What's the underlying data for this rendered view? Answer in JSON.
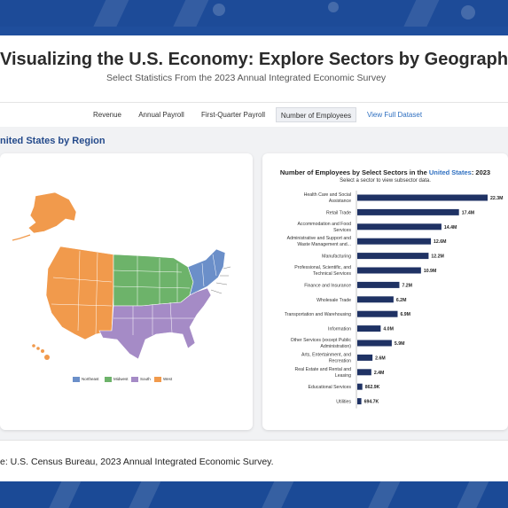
{
  "header": {
    "title": "Visualizing the U.S. Economy: Explore Sectors by Geography",
    "subtitle": "Select Statistics From the 2023 Annual Integrated Economic Survey"
  },
  "tabs": [
    {
      "label": "Revenue"
    },
    {
      "label": "Annual Payroll"
    },
    {
      "label": "First-Quarter Payroll"
    },
    {
      "label": "Number of Employees"
    },
    {
      "label": "View Full Dataset"
    }
  ],
  "map_panel": {
    "title": "nited States by Region",
    "legend": [
      {
        "label": "Northeast",
        "color": "#6b8fc9"
      },
      {
        "label": "Midwest",
        "color": "#6db36a"
      },
      {
        "label": "South",
        "color": "#a58bc6"
      },
      {
        "label": "West",
        "color": "#f19a4c"
      }
    ]
  },
  "chart_panel": {
    "title_prefix": "Number of Employees by Select Sectors in the",
    "title_highlight": "United States",
    "title_suffix": ": 2023",
    "subtitle": "Select a sector to view subsector data."
  },
  "chart_data": {
    "type": "bar",
    "orientation": "horizontal",
    "title": "Number of Employees by Select Sectors in the United States: 2023",
    "bar_color": "#1f3264",
    "categories": [
      [
        "Health Care and Social",
        "Assistance"
      ],
      [
        "Retail Trade"
      ],
      [
        "Accommodation and Food",
        "Services"
      ],
      [
        "Administrative and Support and",
        "Waste Management and..."
      ],
      [
        "Manufacturing"
      ],
      [
        "Professional, Scientific, and",
        "Technical Services"
      ],
      [
        "Finance and Insurance"
      ],
      [
        "Wholesale Trade"
      ],
      [
        "Transportation and Warehousing"
      ],
      [
        "Information"
      ],
      [
        "Other Services (except Public",
        "Administration)"
      ],
      [
        "Arts, Entertainment, and",
        "Recreation"
      ],
      [
        "Real Estate and Rental and",
        "Leasing"
      ],
      [
        "Educational Services"
      ],
      [
        "Utilities"
      ]
    ],
    "values": [
      22.3,
      17.4,
      14.4,
      12.6,
      12.2,
      10.9,
      7.2,
      6.2,
      6.9,
      4.0,
      5.9,
      2.6,
      2.4,
      0.8629,
      0.6947
    ],
    "value_labels": [
      "22.3M",
      "17.4M",
      "14.4M",
      "12.6M",
      "12.2M",
      "10.9M",
      "7.2M",
      "6.2M",
      "6.9M",
      "4.0M",
      "5.9M",
      "2.6M",
      "2.4M",
      "862.9K",
      "694.7K"
    ],
    "units": "millions of employees"
  },
  "source_text": "e: U.S. Census Bureau, 2023 Annual Integrated Economic Survey."
}
